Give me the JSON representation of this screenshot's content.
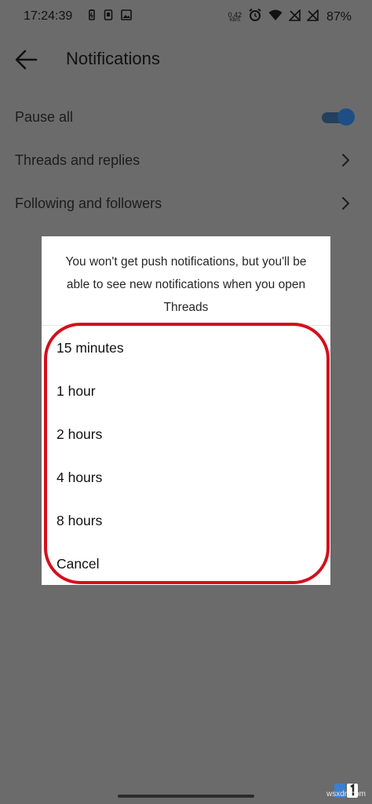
{
  "status_bar": {
    "time": "17:24:39",
    "net_speed_value": "0.42",
    "net_speed_unit": "KB/S",
    "battery": "87%",
    "icons": [
      "battery-saver-icon",
      "sim-icon",
      "image-icon",
      "alarm-icon",
      "wifi-icon",
      "no-signal-icon",
      "no-signal-icon"
    ]
  },
  "header": {
    "title": "Notifications",
    "back_icon": "arrow-left-icon"
  },
  "settings": {
    "items": [
      {
        "label": "Pause all",
        "control": "toggle",
        "toggle_on": true
      },
      {
        "label": "Threads and replies",
        "control": "chevron"
      },
      {
        "label": "Following and followers",
        "control": "chevron"
      }
    ]
  },
  "dialog": {
    "message": "You won't get push notifications, but you'll be able to see new notifications when you open Threads",
    "options": [
      {
        "label": "15 minutes"
      },
      {
        "label": "1 hour"
      },
      {
        "label": "2 hours"
      },
      {
        "label": "4 hours"
      },
      {
        "label": "8 hours"
      },
      {
        "label": "Cancel"
      }
    ]
  },
  "annotation": {
    "highlight_color": "#d40f1c"
  },
  "watermark": {
    "text": "wsxdn.com"
  },
  "colors": {
    "scrim": "#6b6b6b",
    "toggle_accent": "#1d4f86"
  }
}
